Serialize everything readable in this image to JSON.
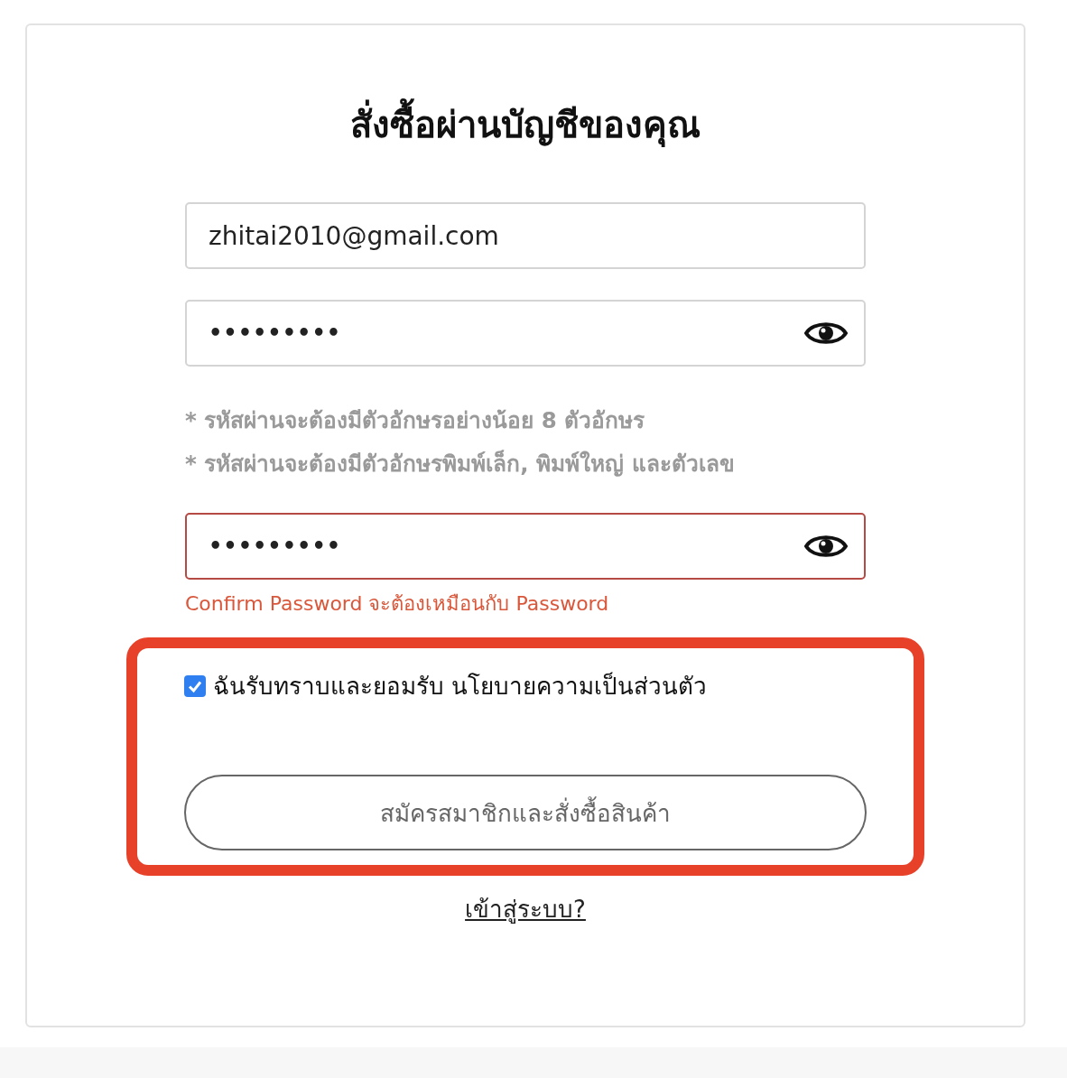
{
  "title": "สั่งซื้อผ่านบัญชีของคุณ",
  "email": {
    "value": "zhitai2010@gmail.com"
  },
  "password": {
    "value": "•••••••••",
    "error": false
  },
  "hints": [
    "* รหัสผ่านจะต้องมีตัวอักษรอย่างน้อย 8 ตัวอักษร",
    "* รหัสผ่านจะต้องมีตัวอักษรพิมพ์เล็ก, พิมพ์ใหญ่ และตัวเลข"
  ],
  "confirm_password": {
    "value": "•••••••••",
    "error": true
  },
  "error_message": "Confirm Password จะต้องเหมือนกับ Password",
  "consent": {
    "highlighted": true,
    "checked": true,
    "label": "ฉันรับทราบและยอมรับ นโยบายความเป็นส่วนตัว"
  },
  "submit_button": "สมัครสมาชิกและสั่งซื้อสินค้า",
  "login_link": "เข้าสู่ระบบ?"
}
